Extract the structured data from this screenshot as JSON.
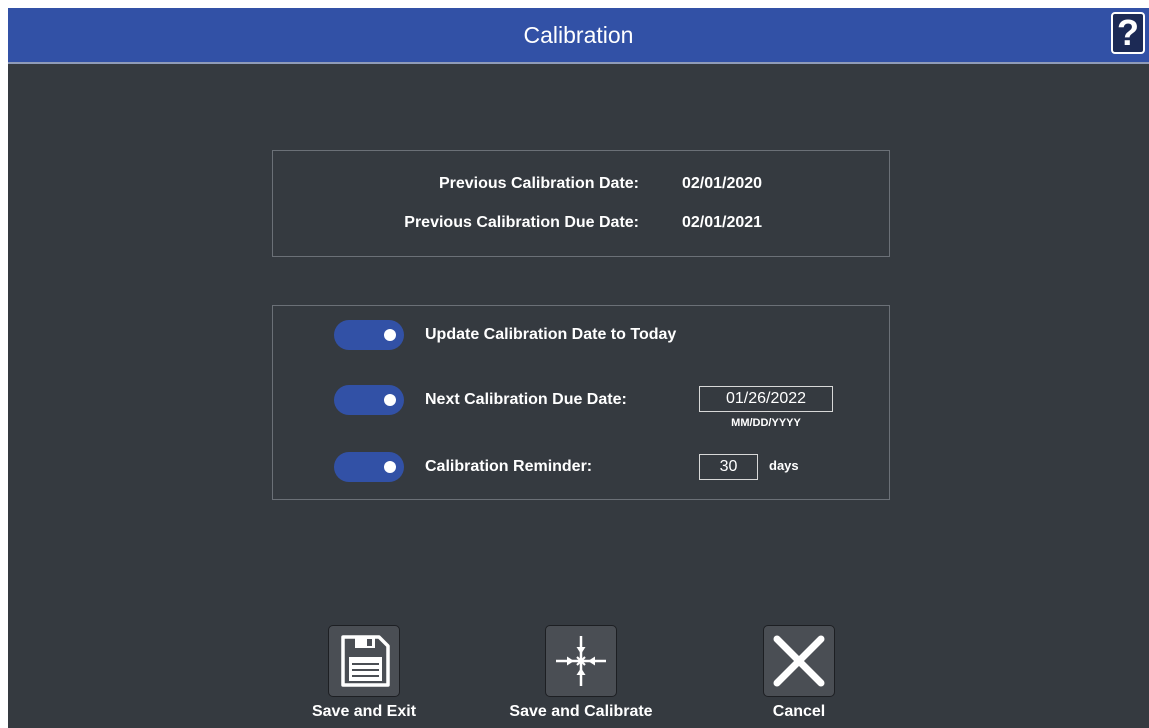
{
  "window": {
    "title": "Calibration",
    "help_label": "?"
  },
  "previous": {
    "calibration_date_label": "Previous Calibration Date:",
    "calibration_date_value": "02/01/2020",
    "due_date_label": "Previous Calibration Due Date:",
    "due_date_value": "02/01/2021"
  },
  "options": {
    "update_today": {
      "label": "Update Calibration Date to Today",
      "enabled": true
    },
    "next_due": {
      "label": "Next Calibration Due Date:",
      "enabled": true,
      "value": "01/26/2022",
      "format_hint": "MM/DD/YYYY"
    },
    "reminder": {
      "label": "Calibration Reminder:",
      "enabled": true,
      "value": "30",
      "unit": "days"
    }
  },
  "actions": {
    "save_exit": {
      "label": "Save and Exit",
      "icon": "floppy-disk-icon"
    },
    "save_calibrate": {
      "label": "Save and Calibrate",
      "icon": "calibrate-crosshair-icon"
    },
    "cancel": {
      "label": "Cancel",
      "icon": "x-icon"
    }
  },
  "colors": {
    "accent": "#3251a6",
    "background": "#353a40",
    "text": "#ffffff"
  }
}
